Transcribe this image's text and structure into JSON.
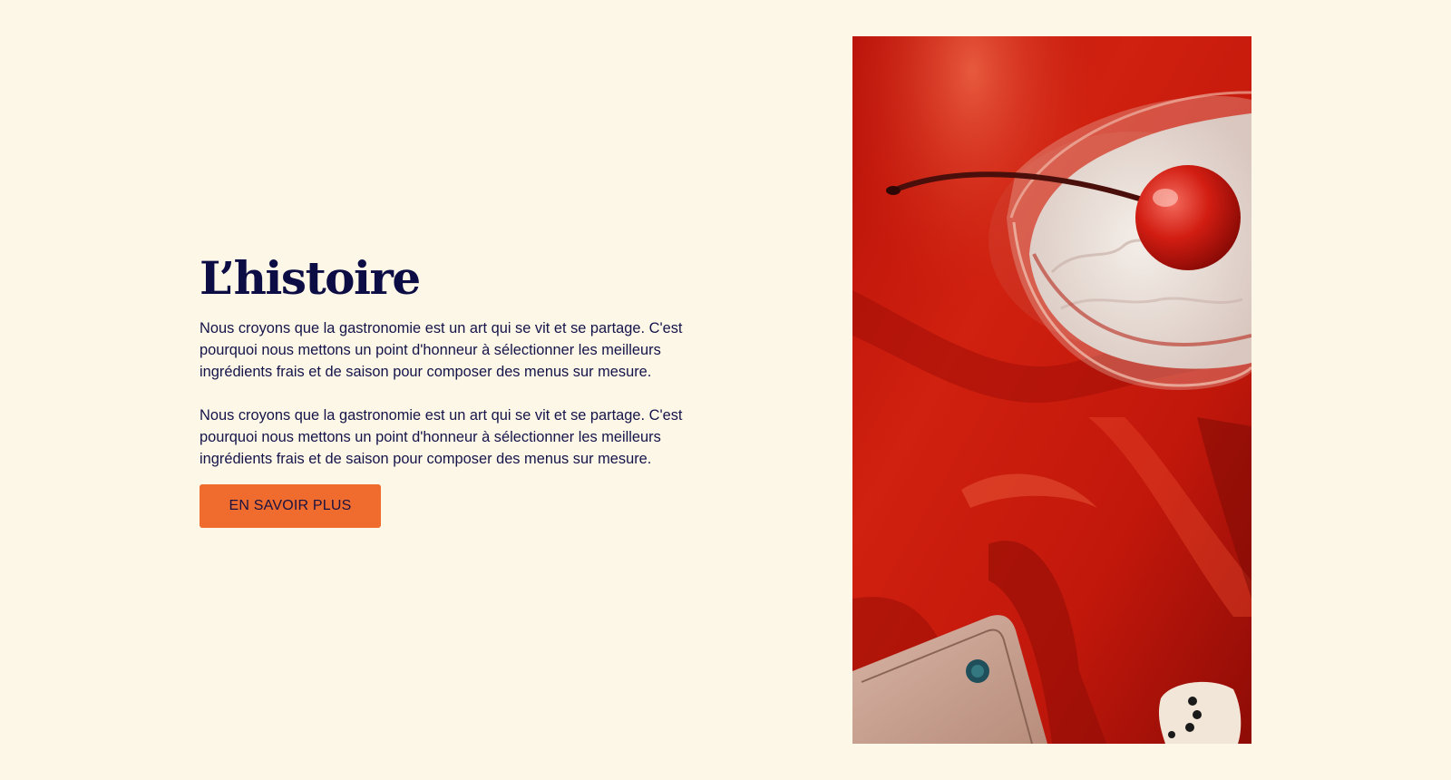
{
  "section": {
    "title": "L’histoire",
    "paragraphs": [
      "Nous croyons que la gastronomie est un art qui se vit et se partage. C'est pourquoi nous mettons un point d'honneur à sélectionner les meilleurs ingrédients frais et de saison pour composer des menus sur mesure.",
      "Nous croyons que la gastronomie est un art qui se vit et se partage. C'est pourquoi nous mettons un point d'honneur à sélectionner les meilleurs ingrédients frais et de saison pour composer des menus sur mesure."
    ],
    "cta_label": "EN SAVOIR PLUS"
  },
  "image": {
    "subject": "dessert-coupe-photo"
  },
  "colors": {
    "background": "#fdf7e7",
    "heading": "#0d0d45",
    "body_text": "#14144a",
    "button": "#ef6c2e",
    "photo_red": "#c8150a"
  }
}
